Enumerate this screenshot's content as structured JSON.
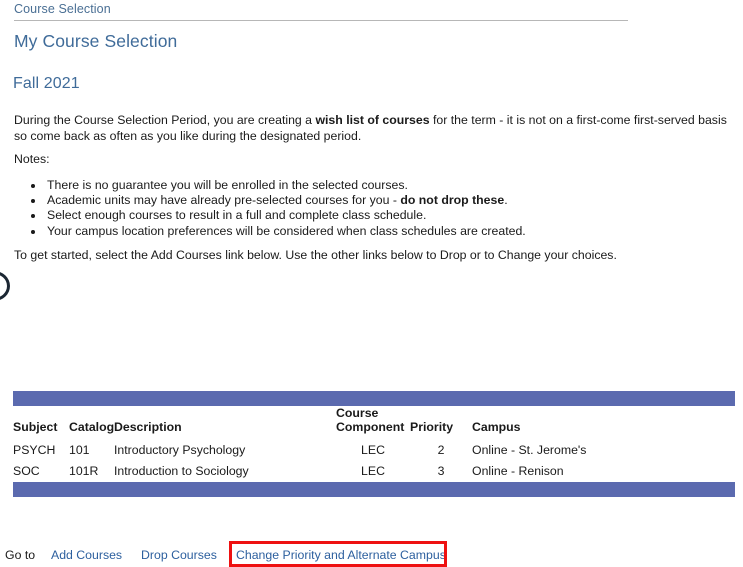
{
  "breadcrumb": {
    "label": "Course Selection"
  },
  "header": {
    "page_title": "My Course Selection",
    "term_title": "Fall 2021"
  },
  "intro": {
    "para_part1": "During the Course Selection Period, you are creating a ",
    "para_bold": "wish list of courses",
    "para_part2": " for the term - it is not on a first-come first-served basis so come back as often as you like during the designated period.",
    "notes_label": "Notes:",
    "notes": [
      {
        "text": "There is no guarantee you will be enrolled in the selected courses."
      },
      {
        "pre": "Academic units may have already pre-selected courses for you - ",
        "bold": "do not drop these",
        "post": "."
      },
      {
        "text": "Select enough courses to result in a full and complete class schedule."
      },
      {
        "text": "Your campus location preferences will be considered when class schedules are created."
      }
    ],
    "get_started": "To get started, select the Add Courses link below. Use the other links below to Drop or to Change your choices."
  },
  "grid": {
    "columns": {
      "subject": "Subject",
      "catalog": "Catalog",
      "description": "Description",
      "component_line1": "Course",
      "component_line2": "Component",
      "priority": "Priority",
      "campus": "Campus"
    },
    "rows": [
      {
        "subject": "PSYCH",
        "catalog": "101",
        "description": "Introductory Psychology",
        "component": "LEC",
        "priority": "2",
        "campus": "Online - St. Jerome's"
      },
      {
        "subject": "SOC",
        "catalog": "101R",
        "description": "Introduction to Sociology",
        "component": "LEC",
        "priority": "3",
        "campus": "Online - Renison"
      }
    ]
  },
  "footer": {
    "goto_label": "Go to",
    "add_courses": "Add Courses",
    "drop_courses": "Drop Courses",
    "change_priority": "Change Priority and Alternate Campus"
  },
  "colors": {
    "heading_blue": "#3f6b99",
    "grid_bar_blue": "#5b6aaf",
    "link_blue": "#2c5f9e",
    "highlight_red": "#ee1111"
  }
}
